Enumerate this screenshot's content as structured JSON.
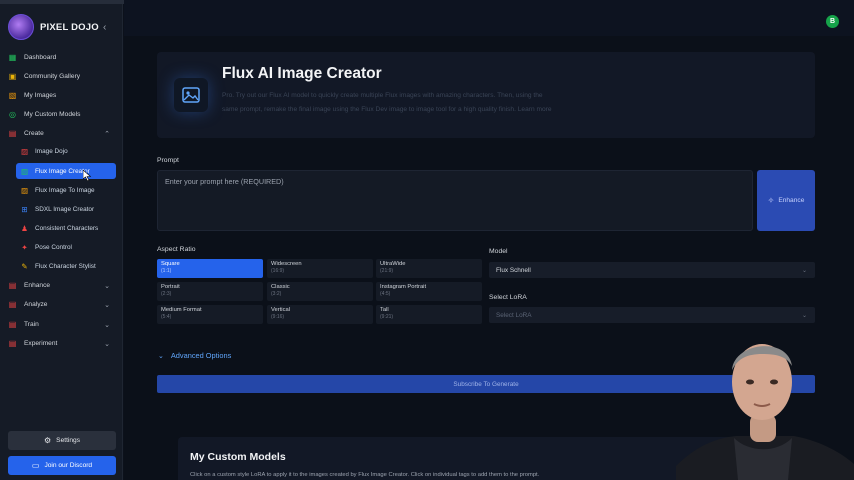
{
  "brand": {
    "name": "PIXEL DOJO"
  },
  "sidebar": {
    "items": [
      {
        "label": "Dashboard",
        "icon": "grid-icon",
        "color": "#22c55e"
      },
      {
        "label": "Community Gallery",
        "icon": "gallery-icon",
        "color": "#eab308"
      },
      {
        "label": "My Images",
        "icon": "image-icon",
        "color": "#f59e0b"
      },
      {
        "label": "My Custom Models",
        "icon": "model-icon",
        "color": "#22c55e"
      },
      {
        "label": "Create",
        "icon": "create-icon",
        "color": "#ef4444",
        "expanded": true
      }
    ],
    "create_sub": [
      {
        "label": "Image Dojo",
        "icon": "image-icon",
        "color": "#ef4444"
      },
      {
        "label": "Flux Image Creator",
        "icon": "flux-icon",
        "color": "#22c55e",
        "active": true
      },
      {
        "label": "Flux Image To Image",
        "icon": "image-to-image-icon",
        "color": "#f59e0b"
      },
      {
        "label": "SDXL Image Creator",
        "icon": "sdxl-icon",
        "color": "#3b82f6"
      },
      {
        "label": "Consistent Characters",
        "icon": "characters-icon",
        "color": "#ef4444"
      },
      {
        "label": "Pose Control",
        "icon": "pose-icon",
        "color": "#ef4444"
      },
      {
        "label": "Flux Character Stylist",
        "icon": "brush-icon",
        "color": "#eab308"
      }
    ],
    "groups": [
      {
        "label": "Enhance",
        "icon": "enhance-icon",
        "color": "#ef4444"
      },
      {
        "label": "Analyze",
        "icon": "analyze-icon",
        "color": "#ef4444"
      },
      {
        "label": "Train",
        "icon": "train-icon",
        "color": "#ef4444"
      },
      {
        "label": "Experiment",
        "icon": "experiment-icon",
        "color": "#ef4444"
      }
    ],
    "settings_label": "Settings",
    "discord_label": "Join our Discord"
  },
  "user": {
    "initial": "B",
    "color": "#16a34a"
  },
  "hero": {
    "title": "Flux AI Image Creator",
    "description": "Pro. Try out our Flux AI model to quickly create multiple Flux images with amazing characters. Then, using the same prompt, remake the final image using the Flux Dev image to image tool for a high quality finish. Learn more"
  },
  "prompt": {
    "label": "Prompt",
    "placeholder": "Enter your prompt here (REQUIRED)",
    "enhance_label": "Enhance"
  },
  "aspect_ratio": {
    "label": "Aspect Ratio",
    "options": [
      {
        "name": "Square",
        "ratio": "(1:1)",
        "selected": true
      },
      {
        "name": "Widescreen",
        "ratio": "(16:9)"
      },
      {
        "name": "UltraWide",
        "ratio": "(21:9)"
      },
      {
        "name": "Portrait",
        "ratio": "(2:3)"
      },
      {
        "name": "Classic",
        "ratio": "(3:2)"
      },
      {
        "name": "Instagram Portrait",
        "ratio": "(4:5)"
      },
      {
        "name": "Medium Format",
        "ratio": "(5:4)"
      },
      {
        "name": "Vertical",
        "ratio": "(9:16)"
      },
      {
        "name": "Tall",
        "ratio": "(9:21)"
      }
    ]
  },
  "model": {
    "label": "Model",
    "value": "Flux Schnell"
  },
  "lora": {
    "label": "Select LoRA",
    "placeholder": "Select LoRA"
  },
  "advanced_label": "Advanced Options",
  "subscribe_label": "Subscribe To Generate",
  "custom_models": {
    "title": "My Custom Models",
    "description": "Click on a custom style LoRA to apply it to the images created by Flux Image Creator. Click on individual tags to add them to the prompt."
  },
  "colors": {
    "accent": "#2563eb",
    "background": "#0b1019",
    "sidebar": "#151b26"
  }
}
